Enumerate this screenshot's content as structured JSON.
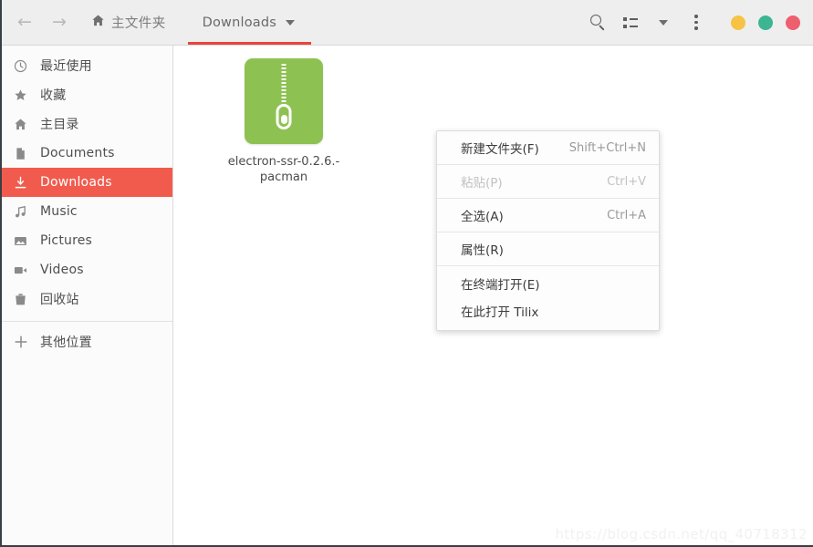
{
  "header": {
    "back_icon": "arrow-left-icon",
    "forward_icon": "arrow-right-icon",
    "home_icon": "home-icon",
    "home_label": "主文件夹",
    "tab_label": "Downloads",
    "tab_caret": "chevron-down-icon",
    "tab_underline_color": "#e8453c",
    "search_icon": "search-icon",
    "view_icon": "list-view-icon",
    "view_caret": "chevron-down-icon",
    "menu_icon": "overflow-menu-icon",
    "window_controls": [
      {
        "name": "minimize",
        "color": "#f6c344"
      },
      {
        "name": "maximize",
        "color": "#3cb593"
      },
      {
        "name": "close",
        "color": "#ed5f6d"
      }
    ]
  },
  "sidebar": {
    "highlight_color": "#f15b4e",
    "items": [
      {
        "icon": "clock-icon",
        "label": "最近使用",
        "active": false
      },
      {
        "icon": "star-icon",
        "label": "收藏",
        "active": false
      },
      {
        "icon": "home-icon",
        "label": "主目录",
        "active": false
      },
      {
        "icon": "document-icon",
        "label": "Documents",
        "active": false
      },
      {
        "icon": "download-icon",
        "label": "Downloads",
        "active": true
      },
      {
        "icon": "music-icon",
        "label": "Music",
        "active": false
      },
      {
        "icon": "picture-icon",
        "label": "Pictures",
        "active": false
      },
      {
        "icon": "video-icon",
        "label": "Videos",
        "active": false
      },
      {
        "icon": "trash-icon",
        "label": "回收站",
        "active": false
      }
    ],
    "other_locations": {
      "icon": "plus-icon",
      "label": "其他位置"
    }
  },
  "files": [
    {
      "icon": "archive-zip-icon",
      "icon_color": "#8dc252",
      "name_line1": "electron-ssr-0.2.6.-",
      "name_line2": "pacman"
    }
  ],
  "context_menu": {
    "items": [
      {
        "label": "新建文件夹(F)",
        "accel": "Shift+Ctrl+N",
        "disabled": false
      },
      {
        "label": "粘贴(P)",
        "accel": "Ctrl+V",
        "disabled": true
      },
      {
        "label": "全选(A)",
        "accel": "Ctrl+A",
        "disabled": false
      },
      {
        "label": "属性(R)",
        "accel": "",
        "disabled": false
      }
    ],
    "terminal_items": [
      {
        "label": "在终端打开(E)",
        "accel": ""
      },
      {
        "label": "在此打开 Tilix",
        "accel": ""
      }
    ]
  },
  "watermark": "https://blog.csdn.net/qq_40718312"
}
